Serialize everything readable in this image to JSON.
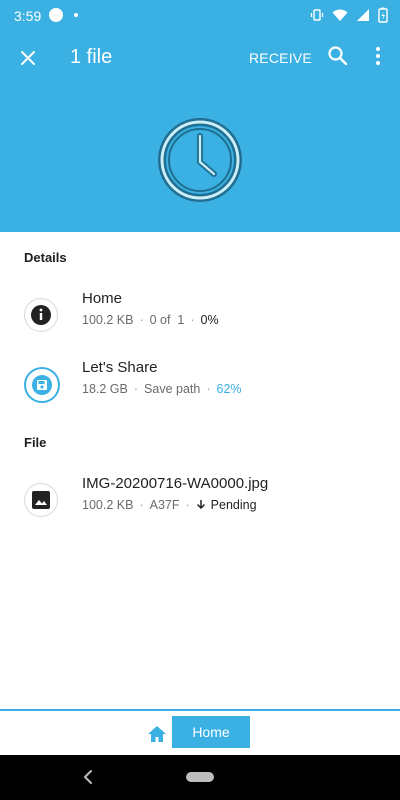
{
  "status": {
    "time": "3:59"
  },
  "toolbar": {
    "title": "1 file",
    "receive_label": "RECEIVE"
  },
  "details": {
    "label": "Details",
    "items": [
      {
        "title": "Home",
        "size": "100.2 KB",
        "count": "0 of  1",
        "percent": "0%",
        "icon": "info-icon"
      },
      {
        "title": "Let's Share",
        "size": "18.2 GB",
        "path": "Save path",
        "percent": "62%",
        "icon": "save-icon"
      }
    ]
  },
  "file_section": {
    "label": "File",
    "items": [
      {
        "name": "IMG-20200716-WA0000.jpg",
        "size": "100.2 KB",
        "id": "A37F",
        "status": "Pending",
        "icon": "image-icon"
      }
    ]
  },
  "bottom": {
    "home_label": "Home"
  },
  "colors": {
    "accent": "#3bb0e3"
  }
}
